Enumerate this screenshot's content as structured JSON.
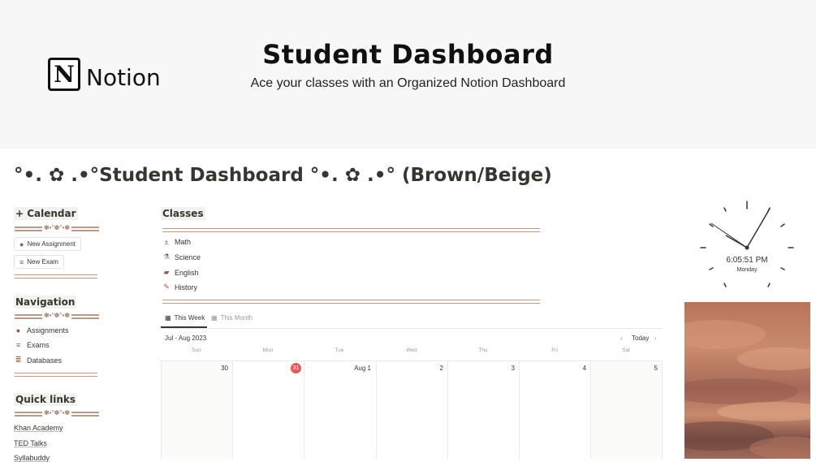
{
  "banner": {
    "logo_glyph": "N",
    "logo_text": "Notion",
    "title": "Student Dashboard",
    "subtitle": "Ace your classes with an Organized Notion Dashboard"
  },
  "page": {
    "title": "°•. ✿ .•°Student Dashboard °•. ✿ .•° (Brown/Beige)"
  },
  "sidebar": {
    "calendar_heading": "+ Calendar",
    "divider_ornament": "✽•°✽°•✽",
    "buttons": [
      {
        "label": "New Assignment",
        "icon": "check-circle-icon"
      },
      {
        "label": "New Exam",
        "icon": "list-pen-icon"
      }
    ],
    "navigation_heading": "Navigation",
    "nav_items": [
      {
        "label": "Assignments",
        "icon": "check-circle-icon"
      },
      {
        "label": "Exams",
        "icon": "list-pen-icon"
      },
      {
        "label": "Databases",
        "icon": "database-icon"
      }
    ],
    "quick_links_heading": "Quick links",
    "links": [
      "Khan Academy",
      "TED Talks",
      "Syllabuddy"
    ]
  },
  "classes": {
    "heading": "Classes",
    "items": [
      {
        "label": "Math",
        "icon": "calculator-icon"
      },
      {
        "label": "Science",
        "icon": "flask-icon"
      },
      {
        "label": "English",
        "icon": "book-icon"
      },
      {
        "label": "History",
        "icon": "quill-icon"
      }
    ]
  },
  "calendar": {
    "tabs": [
      {
        "label": "This Week",
        "active": true
      },
      {
        "label": "This Month",
        "active": false
      }
    ],
    "range": "Jul - Aug 2023",
    "today_button": "Today",
    "prev_arrow": "‹",
    "next_arrow": "›",
    "days": [
      "Sun",
      "Mon",
      "Tue",
      "Wed",
      "Thu",
      "Fri",
      "Sat"
    ],
    "dates": [
      "30",
      "31",
      "Aug 1",
      "2",
      "3",
      "4",
      "5"
    ],
    "today_date": "31"
  },
  "clock": {
    "time": "6:05:51 PM",
    "day": "Monday"
  },
  "colors": {
    "accent_brown": "#8b5e4a",
    "divider": "#b99a8a",
    "today_red": "#eb5757"
  }
}
